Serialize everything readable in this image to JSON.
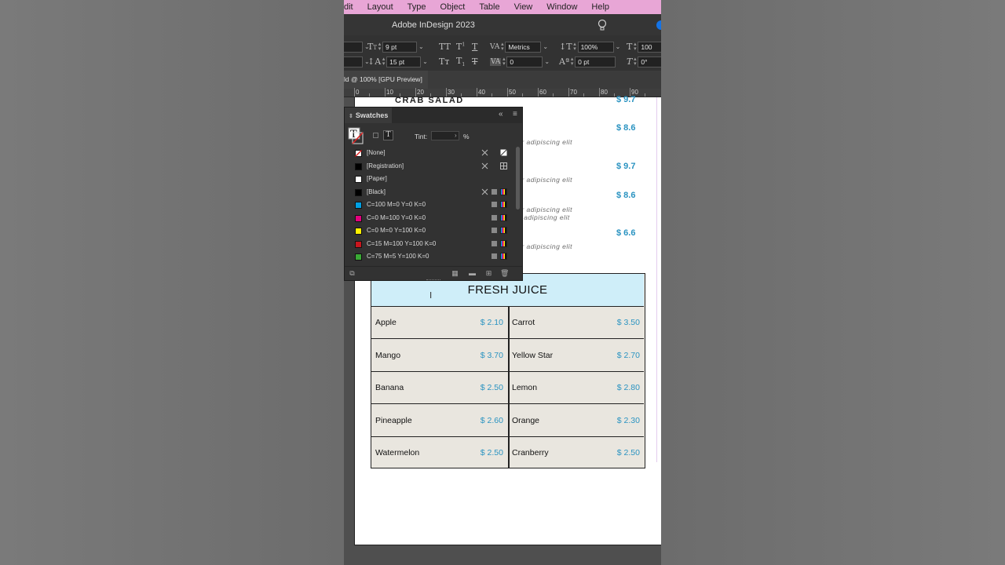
{
  "menubar": {
    "items": [
      "dit",
      "Layout",
      "Type",
      "Object",
      "Table",
      "View",
      "Window",
      "Help"
    ]
  },
  "titlebar": {
    "title": "Adobe InDesign 2023"
  },
  "control_panel": {
    "font_size": "9 pt",
    "leading": "15 pt",
    "kerning": "Metrics",
    "tracking": "0",
    "horizontal_scale": "100%",
    "vertical_scale": "100",
    "baseline_shift": "0 pt",
    "skew": "0°"
  },
  "document_tab": {
    "label": "ld @ 100% [GPU Preview]"
  },
  "ruler": {
    "labels": [
      "0",
      "10",
      "20",
      "30",
      "40",
      "50",
      "60",
      "70",
      "80",
      "90"
    ]
  },
  "page": {
    "top_item": {
      "name": "CRAB SALAD",
      "price": "$ 9.7"
    },
    "prices": [
      "$ 8.6",
      "$ 9.7",
      "$ 8.6",
      "$ 6.6"
    ],
    "descriptions": [
      "etur adipiscing elit",
      "etur adipiscing elit",
      "etur adipiscing elit",
      "r adipiscing elit",
      "etur adipiscing elit"
    ],
    "juice": {
      "title": "FRESH JUICE",
      "rows": [
        {
          "left_name": "Apple",
          "left_price": "$ 2.10",
          "right_name": "Carrot",
          "right_price": "$ 3.50"
        },
        {
          "left_name": "Mango",
          "left_price": "$ 3.70",
          "right_name": "Yellow Star",
          "right_price": "$ 2.70"
        },
        {
          "left_name": "Banana",
          "left_price": "$ 2.50",
          "right_name": "Lemon",
          "right_price": "$ 2.80"
        },
        {
          "left_name": "Pineapple",
          "left_price": "$ 2.60",
          "right_name": "Orange",
          "right_price": "$ 2.30"
        },
        {
          "left_name": "Watermelon",
          "left_price": "$ 2.50",
          "right_name": "Cranberry",
          "right_price": "$ 2.50"
        }
      ]
    }
  },
  "swatches": {
    "title": "Swatches",
    "tint_label": "Tint:",
    "tint_unit": "%",
    "items": [
      {
        "name": "[None]",
        "color": "none"
      },
      {
        "name": "[Registration]",
        "color": "#000000"
      },
      {
        "name": "[Paper]",
        "color": "#ffffff"
      },
      {
        "name": "[Black]",
        "color": "#000000"
      },
      {
        "name": "C=100 M=0 Y=0 K=0",
        "color": "#00a0e3"
      },
      {
        "name": "C=0 M=100 Y=0 K=0",
        "color": "#e4007e"
      },
      {
        "name": "C=0 M=0 Y=100 K=0",
        "color": "#fff100"
      },
      {
        "name": "C=15 M=100 Y=100 K=0",
        "color": "#c8161d"
      },
      {
        "name": "C=75 M=5 Y=100 K=0",
        "color": "#3aa935"
      }
    ]
  },
  "colors": {
    "accent_price": "#2a93c1",
    "juice_header_bg": "#cfeef9",
    "menubar_bg": "#e8a6d6"
  }
}
